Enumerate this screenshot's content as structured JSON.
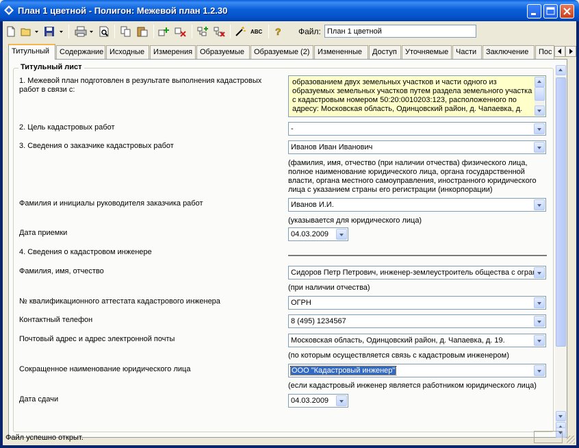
{
  "window": {
    "title": "План 1 цветной - Полигон: Межевой план 1.2.30"
  },
  "toolbar": {
    "icons": [
      "new-document-icon",
      "open-folder-icon",
      "save-icon",
      "print-icon",
      "print-preview-icon",
      "copy-icon",
      "paste-icon",
      "add-row-icon",
      "delete-row-icon",
      "add-block-icon",
      "delete-block-icon",
      "magic-wand-icon",
      "spellcheck-icon",
      "help-icon"
    ],
    "spellcheck_text": "ABC",
    "help_text": "?",
    "file_label": "Файл:",
    "file_value": "План 1 цветной"
  },
  "tabs": [
    {
      "label": "Титульный",
      "active": true
    },
    {
      "label": "Содержание"
    },
    {
      "label": "Исходные"
    },
    {
      "label": "Измерения"
    },
    {
      "label": "Образуемые"
    },
    {
      "label": "Образуемые (2)"
    },
    {
      "label": "Измененные"
    },
    {
      "label": "Доступ"
    },
    {
      "label": "Уточняемые"
    },
    {
      "label": "Части"
    },
    {
      "label": "Заключение"
    },
    {
      "label": "Пос"
    }
  ],
  "form": {
    "group_title": "Титульный лист",
    "q1_label": "1. Межевой план подготовлен в результате выполнения кадастровых работ в связи с:",
    "q1_value": "образованием двух земельных участков и части одного из образуемых земельных участков путем раздела земельного участка с кадастровым номером 50:20:0010203:123, расположенного по адресу: Московская область, Одинцовский район, д. Чапаевка, д.",
    "q2_label": "2. Цель кадастровых работ",
    "q2_value": "-",
    "q3_label": "3. Сведения о заказчике кадастровых работ",
    "q3_value": "Иванов Иван Иванович",
    "q3_note": "(фамилия, имя, отчество (при наличии отчества) физического лица, полное наименование юридического лица, органа государственной власти, органа местного самоуправления, иностранного юридического лица с указанием страны его регистрации (инкорпорации)",
    "head_label": "Фамилия и инициалы руководителя заказчика работ",
    "head_value": "Иванов И.И.",
    "head_note": "(указывается для юридического лица)",
    "accept_label": "Дата приемки",
    "accept_value": "04.03.2009",
    "q4_label": "4. Сведения о кадастровом инженере",
    "fio_label": "Фамилия, имя, отчество",
    "fio_value": "Сидоров Петр Петрович, инженер-землеустроитель общества с огран",
    "fio_note": "(при наличии отчества)",
    "cert_label": "№ квалификационного аттестата кадастрового инженера",
    "cert_value": "ОГРН",
    "phone_label": "Контактный телефон",
    "phone_value": "8 (495) 1234567",
    "addr_label": "Почтовый адрес и адрес электронной почты",
    "addr_value": "Московская область, Одинцовский район, д. Чапаевка, д. 19.",
    "addr_note": "(по которым осуществляется связь с кадастровым инженером)",
    "org_label": "Сокращенное наименование юридического лица",
    "org_value": "ООО \"Кадастровый инженер\"",
    "org_note": "(если кадастровый инженер является работником юридического лица)",
    "handover_label": "Дата сдачи",
    "handover_value": "04.03.2009"
  },
  "status": {
    "text": "Файл успешно открыт."
  }
}
